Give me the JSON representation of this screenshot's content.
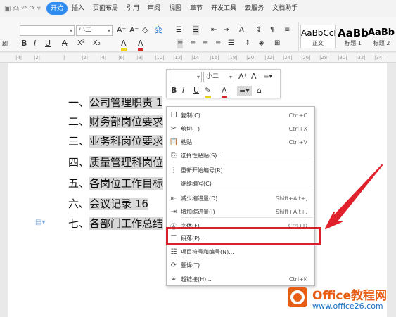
{
  "menubar": {
    "items": [
      "开始",
      "插入",
      "页面布局",
      "引用",
      "审阅",
      "视图",
      "章节",
      "开发工具",
      "云服务",
      "文档助手"
    ],
    "active_index": 0
  },
  "ribbon": {
    "font_size": "小二",
    "styles": [
      {
        "preview": "AaBbCcI",
        "name": "正文"
      },
      {
        "preview": "AaBb",
        "name": "标题 1"
      },
      {
        "preview": "AaBbC",
        "name": "标题 2"
      }
    ],
    "format_row": [
      "B",
      "I",
      "U",
      "A",
      "X²",
      "X₂",
      "A",
      "A"
    ],
    "left_label": "刷"
  },
  "ruler": {
    "ticks": [
      "|4|",
      "|2|",
      "|",
      "|2|",
      "|4|",
      "|6|",
      "|8|",
      "|10|",
      "|12|",
      "|14|",
      "|16|",
      "|18|",
      "|20|",
      "|22|",
      "|24|",
      "|26|",
      "|28|",
      "|30|",
      "|32|",
      "|34|"
    ]
  },
  "document": {
    "lines": [
      {
        "num": "一、",
        "text": "公司管理职责 1"
      },
      {
        "num": "二、",
        "text": "财务部岗位要求"
      },
      {
        "num": "三、",
        "text": "业务科岗位要求"
      },
      {
        "num": "四、",
        "text": "质量管理科岗位"
      },
      {
        "num": "五、",
        "text": "各岗位工作目标"
      },
      {
        "num": "六、",
        "text": "会议记录 16"
      },
      {
        "num": "七、",
        "text": "各部门工作总结"
      }
    ]
  },
  "minibar": {
    "size": "小二",
    "buttons": [
      "B",
      "I",
      "U"
    ]
  },
  "context_menu": {
    "items": [
      {
        "label": "复制(C)",
        "shortcut": "Ctrl+C",
        "icon": "copy-icon"
      },
      {
        "label": "剪切(T)",
        "shortcut": "Ctrl+X",
        "icon": "cut-icon"
      },
      {
        "label": "粘贴",
        "shortcut": "Ctrl+V",
        "icon": "paste-icon"
      },
      {
        "label": "选择性粘贴(S)...",
        "shortcut": "",
        "icon": "paste-special-icon"
      },
      {
        "label": "重新开始编号(R)",
        "shortcut": "",
        "icon": "restart-numbering-icon"
      },
      {
        "label": "继续编号(C)",
        "shortcut": "",
        "icon": ""
      },
      {
        "label": "减少缩进量(D)",
        "shortcut": "Shift+Alt+,",
        "icon": "decrease-indent-icon"
      },
      {
        "label": "增加缩进量(I)",
        "shortcut": "Shift+Alt+.",
        "icon": "increase-indent-icon"
      },
      {
        "label": "字体(F)...",
        "shortcut": "Ctrl+D",
        "icon": "font-icon"
      },
      {
        "label": "段落(P)...",
        "shortcut": "",
        "icon": "paragraph-icon"
      },
      {
        "label": "项目符号和编号(N)...",
        "shortcut": "",
        "icon": "bullets-numbering-icon"
      },
      {
        "label": "翻译(T)",
        "shortcut": "",
        "icon": "translate-icon"
      },
      {
        "label": "超链接(H)...",
        "shortcut": "Ctrl+K",
        "icon": "hyperlink-icon"
      }
    ]
  },
  "watermark": {
    "name": "Office教程网",
    "url": "www.office26.com"
  },
  "colors": {
    "accent": "#2f8bf0",
    "highlight_red": "#d9202b",
    "brand_orange": "#e85d14",
    "brand_blue": "#1b6fc4"
  }
}
